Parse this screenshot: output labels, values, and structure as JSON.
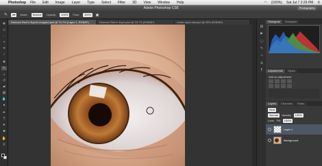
{
  "menubar": {
    "apple": "",
    "app": "Photoshop",
    "items": [
      "File",
      "Edit",
      "Image",
      "Layer",
      "Type",
      "Select",
      "Filter",
      "3D",
      "View",
      "Window",
      "Help"
    ],
    "clock": "Sat Jul 7  2:29 PM",
    "battery": "(100%)"
  },
  "window": {
    "title": "Adobe Photoshop CS6",
    "workspace": "Photography"
  },
  "options": {
    "mode_label": "Mode:",
    "mode": "Normal",
    "opacity_label": "Opacity:",
    "opacity": "100%",
    "flow_label": "Flow:",
    "flow": "100%"
  },
  "tabs": [
    "Remove Red in Eyes2-cropped.psd @ 70.7% (Layer 1, RGB/8*)",
    "Remove Red in Eyes.psd @ 33.7% (RGB/8*)",
    "Under eyes hair.psd @ 25% (RGB/8*)"
  ],
  "panels": {
    "histogram_tabs": [
      "Histogram",
      "Navigator"
    ],
    "adjustments_tabs": [
      "Adjustments",
      "Styles"
    ],
    "adjustments_title": "Add an adjustment",
    "layers_tabs": [
      "Layers",
      "Channels",
      "Paths"
    ],
    "kind": "Kind",
    "blend": "Normal",
    "opacity_label": "Opacity:",
    "opacity": "100%",
    "lock_label": "Lock:",
    "fill_label": "Fill:",
    "fill": "100%",
    "layers": [
      {
        "name": "Layer 1",
        "selected": true
      },
      {
        "name": "Background",
        "selected": false
      }
    ]
  },
  "colors": {
    "ui_dark": "#393939",
    "selection": "#4c5866",
    "iris": "#b26a2e"
  }
}
